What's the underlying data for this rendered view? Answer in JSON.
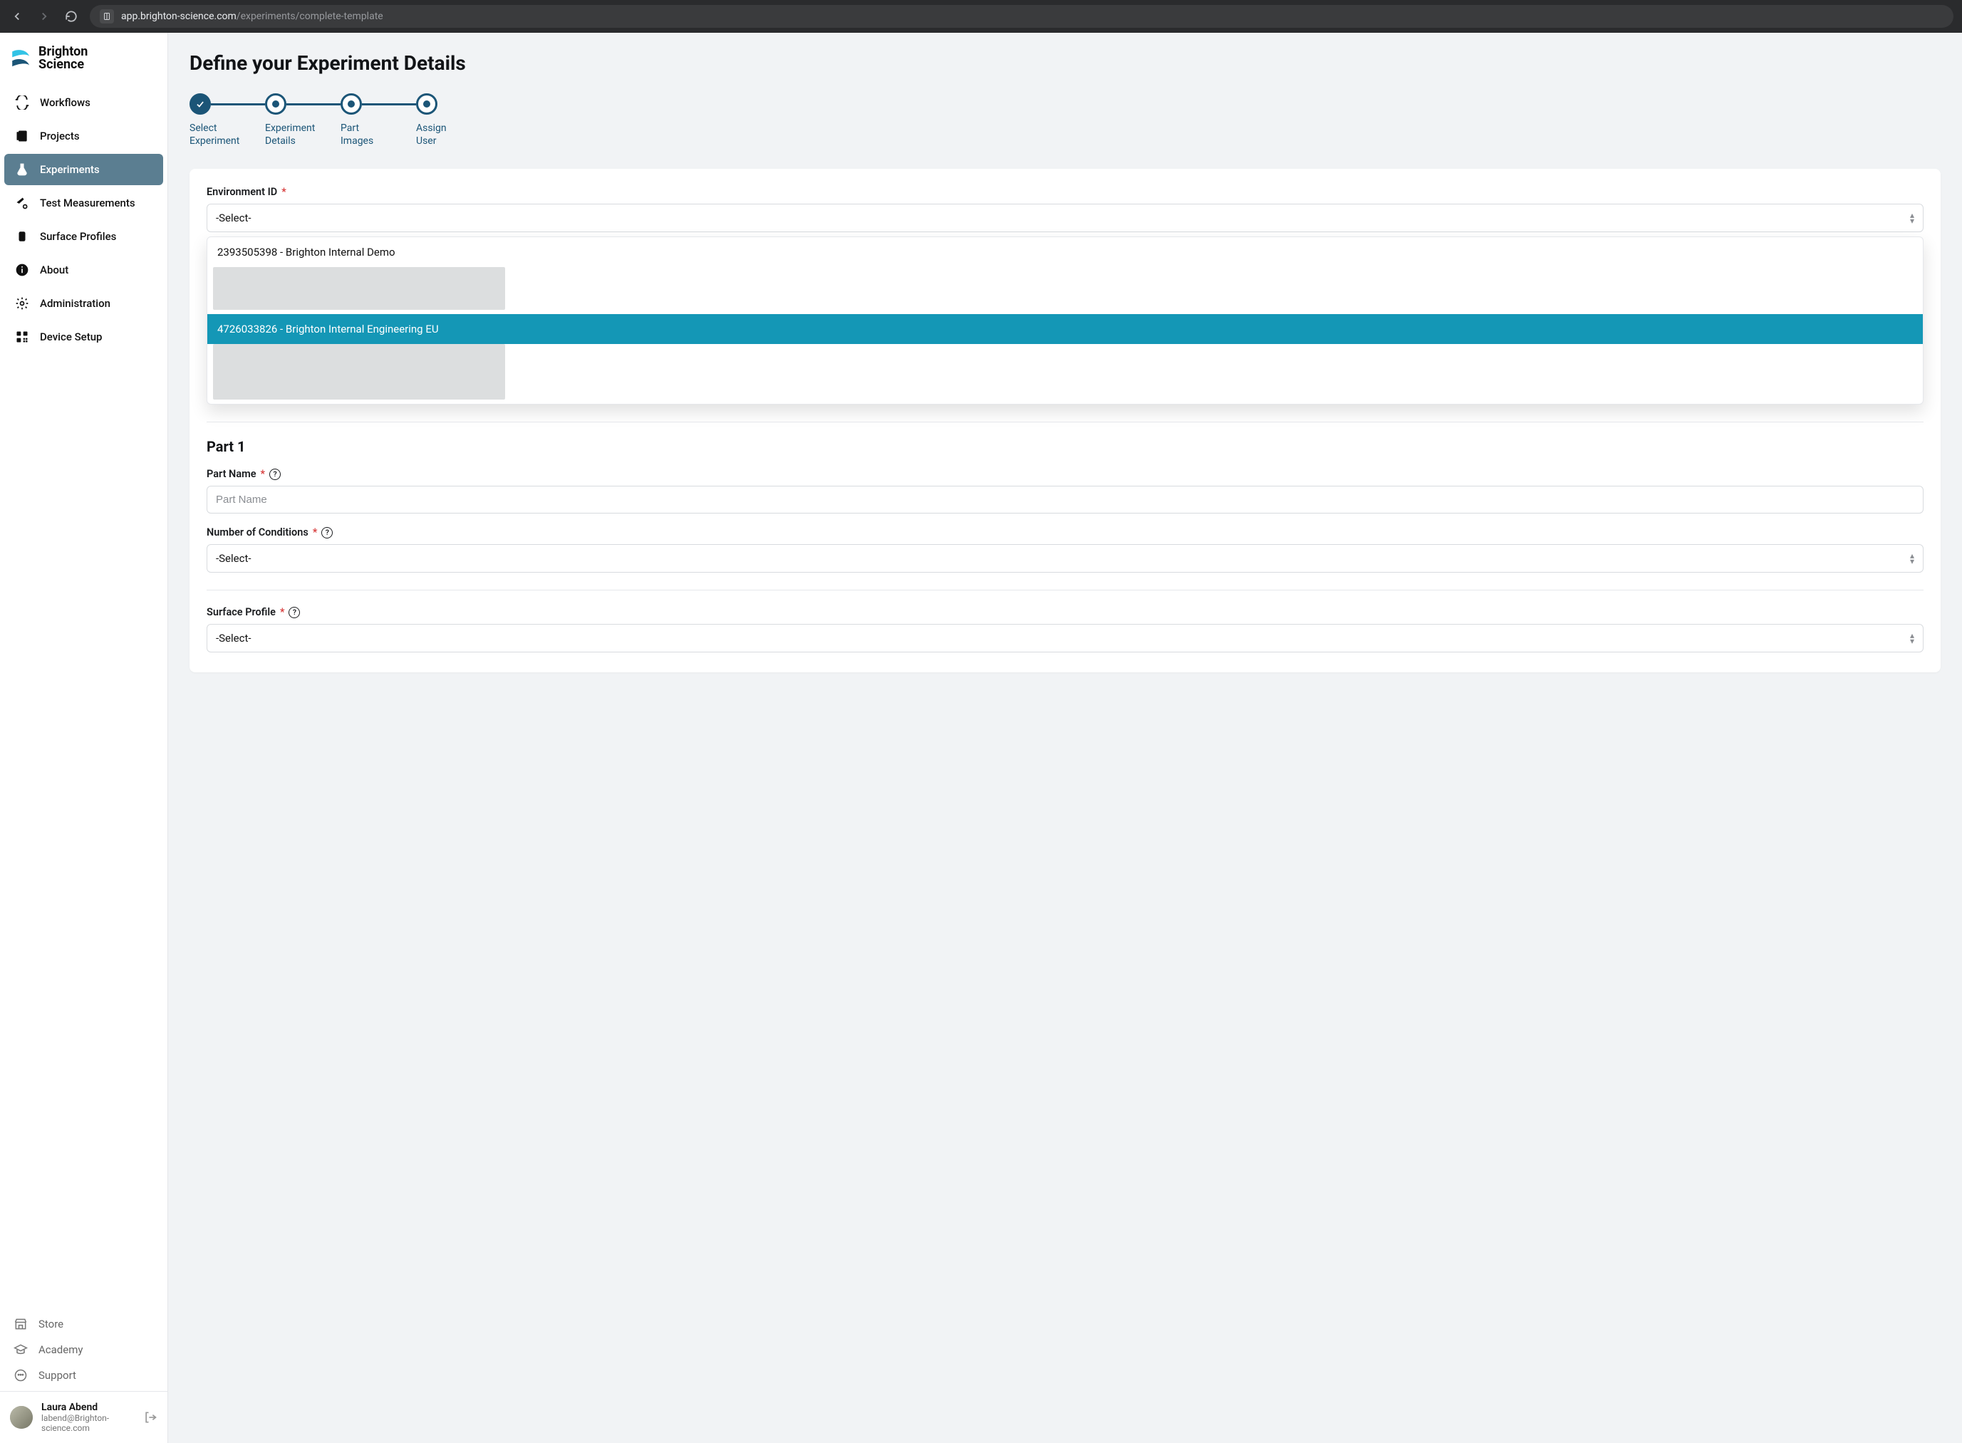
{
  "browser": {
    "url_host": "app.brighton-science.com",
    "url_path": "/experiments/complete-template"
  },
  "brand": {
    "name1": "Brighton",
    "name2": "Science"
  },
  "nav": {
    "items": [
      {
        "label": "Workflows"
      },
      {
        "label": "Projects"
      },
      {
        "label": "Experiments"
      },
      {
        "label": "Test Measurements"
      },
      {
        "label": "Surface Profiles"
      },
      {
        "label": "About"
      },
      {
        "label": "Administration"
      },
      {
        "label": "Device Setup"
      }
    ]
  },
  "footer": {
    "items": [
      {
        "label": "Store"
      },
      {
        "label": "Academy"
      },
      {
        "label": "Support"
      }
    ]
  },
  "user": {
    "name": "Laura Abend",
    "email": "labend@Brighton-science.com"
  },
  "page": {
    "title": "Define your Experiment Details"
  },
  "stepper": {
    "steps": [
      {
        "label_l1": "Select",
        "label_l2": "Experiment"
      },
      {
        "label_l1": "Experiment",
        "label_l2": "Details"
      },
      {
        "label_l1": "Part",
        "label_l2": "Images"
      },
      {
        "label_l1": "Assign",
        "label_l2": "User"
      }
    ]
  },
  "form": {
    "environment": {
      "label": "Environment ID",
      "selected": "-Select-",
      "options": [
        {
          "text": "2393505398 - Brighton Internal Demo"
        },
        {
          "text": "4726033826 - Brighton Internal Engineering EU"
        }
      ]
    },
    "part_section": {
      "title": "Part 1"
    },
    "part_name": {
      "label": "Part Name",
      "placeholder": "Part Name"
    },
    "num_conditions": {
      "label": "Number of Conditions",
      "selected": "-Select-"
    },
    "surface_profile": {
      "label": "Surface Profile",
      "selected": "-Select-"
    }
  }
}
